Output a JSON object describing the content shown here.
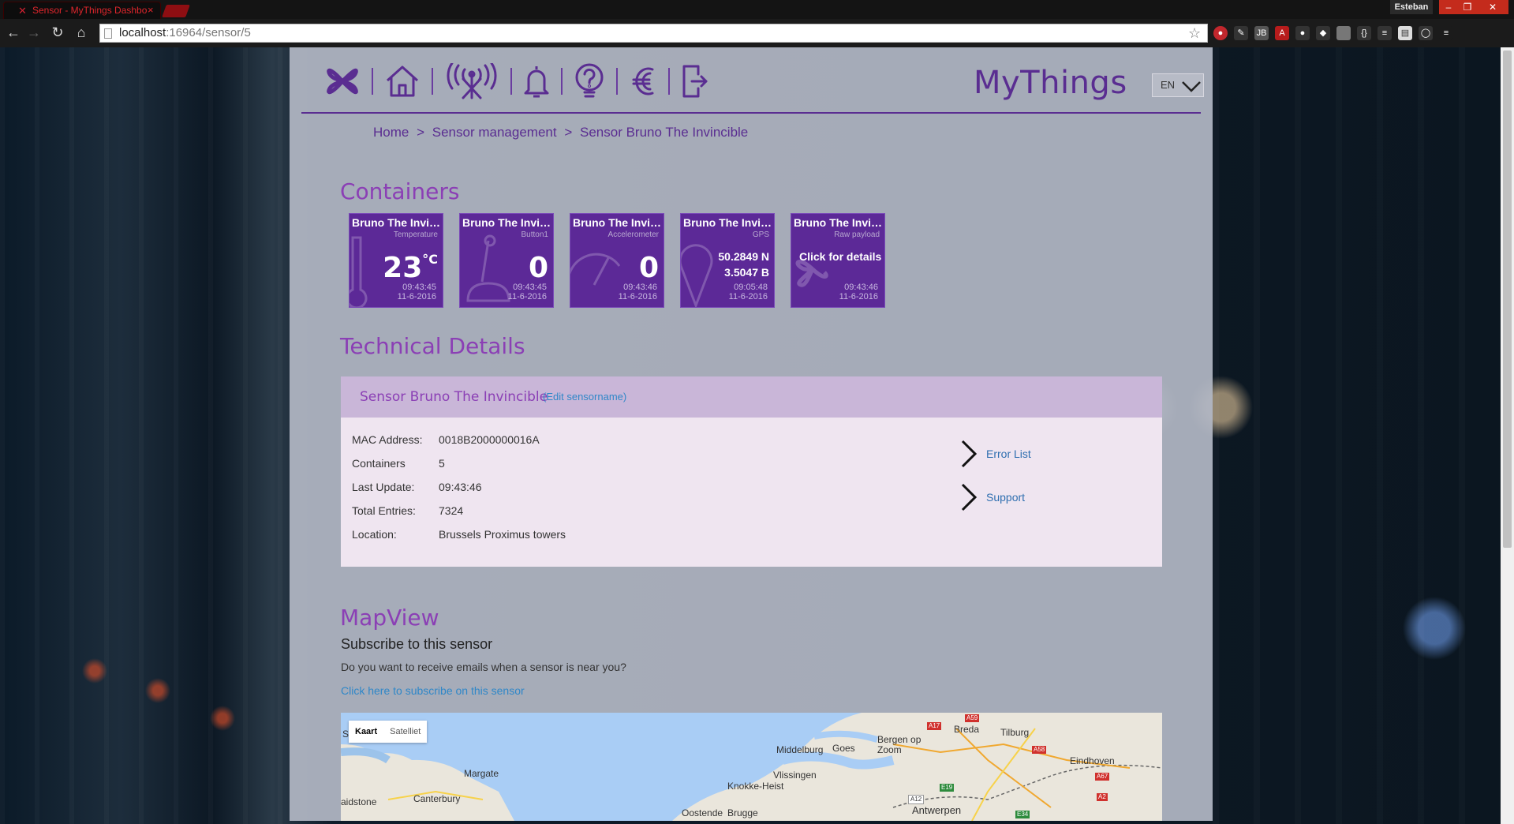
{
  "browser": {
    "tab_title": "Sensor - MyThings Dashbo",
    "tab_close": "×",
    "user_name": "Esteban",
    "url_host": "localhost",
    "url_path": ":16964/sensor/5"
  },
  "header": {
    "brand": "MyThings",
    "language": "EN"
  },
  "breadcrumb": {
    "home": "Home",
    "sep": ">",
    "sensor_management": "Sensor management",
    "current": "Sensor Bruno The Invincible"
  },
  "containers": {
    "heading": "Containers",
    "tiles": [
      {
        "name": "Bruno The Invincible",
        "type": "Temperature",
        "value": "23",
        "unit": "°C",
        "time": "09:43:45",
        "date": "11-6-2016",
        "icon": "thermometer-icon"
      },
      {
        "name": "Bruno The Invincible",
        "type": "Button1",
        "value": "0",
        "unit": "",
        "time": "09:43:45",
        "date": "11-6-2016",
        "icon": "joystick-icon"
      },
      {
        "name": "Bruno The Invincible",
        "type": "Accelerometer",
        "value": "0",
        "unit": "",
        "time": "09:43:46",
        "date": "11-6-2016",
        "icon": "gauge-icon"
      },
      {
        "name": "Bruno The Invincible",
        "type": "GPS",
        "lat": "50.2849 N",
        "lon": "3.5047 B",
        "time": "09:05:48",
        "date": "11-6-2016",
        "icon": "map-pin-icon"
      },
      {
        "name": "Bruno The Invincible",
        "type": "Raw payload",
        "click_text": "Click for details",
        "time": "09:43:46",
        "date": "11-6-2016",
        "icon": "propeller-icon"
      }
    ]
  },
  "technical": {
    "heading": "Technical Details",
    "sensor_title": "Sensor Bruno The Invincible",
    "edit_link": "(Edit sensorname)",
    "rows": [
      {
        "label": "MAC Address:",
        "value": "0018B2000000016A"
      },
      {
        "label": "Containers",
        "value": "5"
      },
      {
        "label": "Last Update:",
        "value": "09:43:46"
      },
      {
        "label": "Total Entries:",
        "value": "7324"
      },
      {
        "label": "Location:",
        "value": "Brussels Proximus towers"
      }
    ],
    "links": [
      "Error List",
      "Support"
    ]
  },
  "mapview": {
    "heading": "MapView",
    "subheading": "Subscribe to this sensor",
    "question": "Do you want to receive emails when a sensor is near you?",
    "subscribe_link": "Click here to subscribe on this sensor",
    "map_type_map": "Kaart",
    "map_type_satellite": "Satelliet",
    "place_labels": [
      "Margate",
      "Canterbury",
      "aidstone",
      "Middelburg",
      "Goes",
      "Bergen op Zoom",
      "Breda",
      "Tilburg",
      "Eindhoven",
      "Vlissingen",
      "Knokke-Heist",
      "Oostende",
      "Brugge",
      "Antwerpen",
      "S"
    ],
    "road_labels": [
      "A17",
      "A59",
      "A58",
      "A67",
      "A12",
      "E19",
      "E34",
      "A2"
    ]
  },
  "colors": {
    "purple": "#5a2d91",
    "tile": "#5c2997",
    "heading": "#8b3fb5",
    "link": "#2f87c8"
  }
}
